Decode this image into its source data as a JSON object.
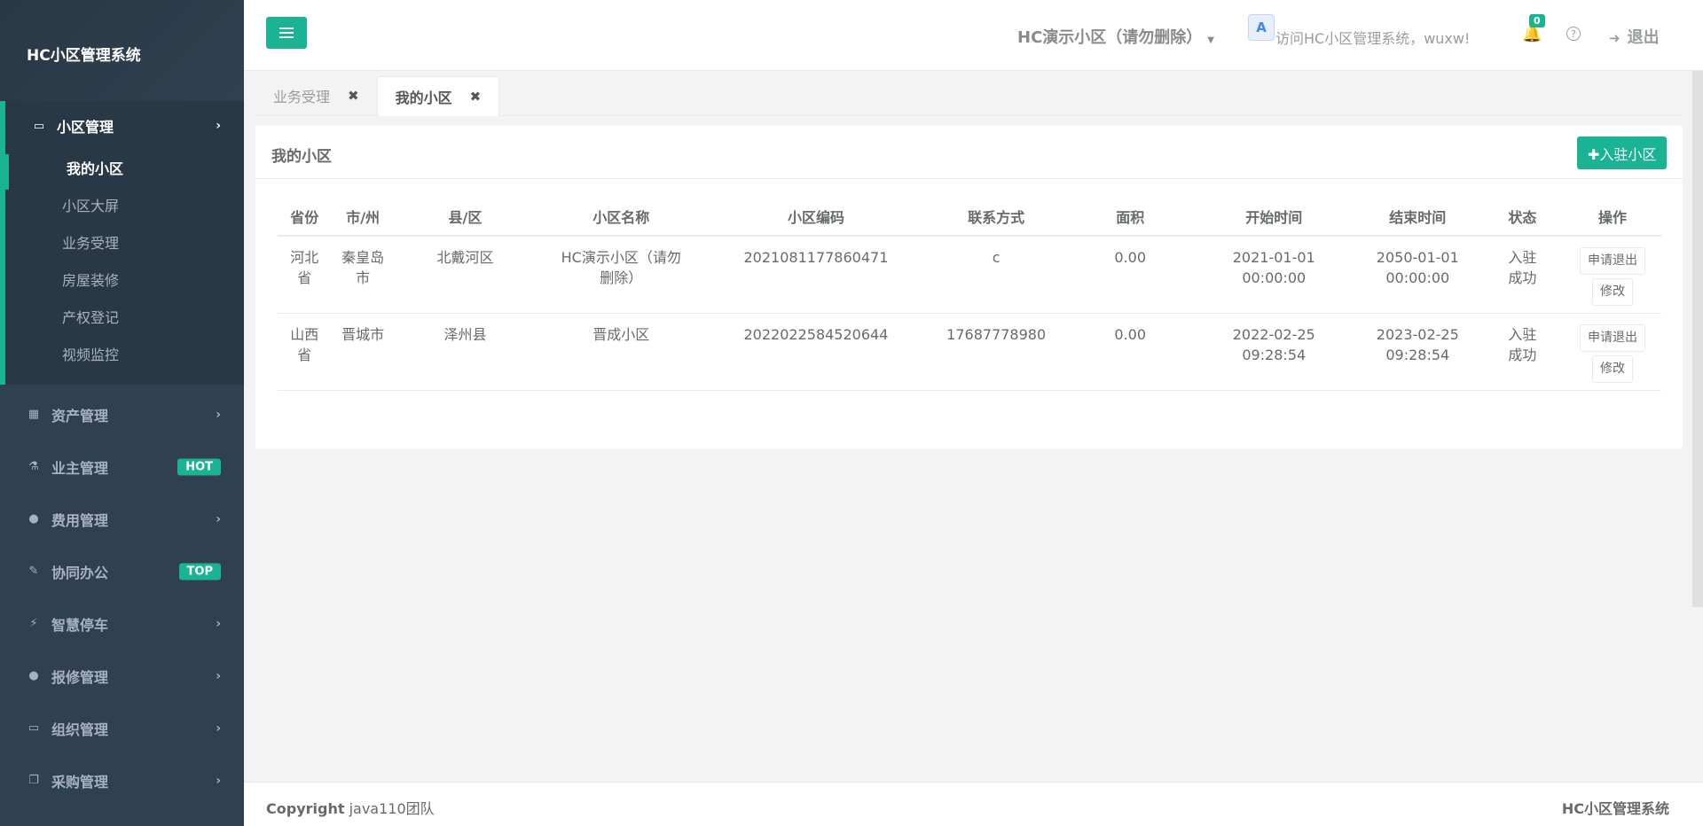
{
  "brand": "HC小区管理系统",
  "sidebar": {
    "active_group": {
      "label": "小区管理",
      "icon": "laptop-icon",
      "arrow": "›"
    },
    "sub_items": [
      {
        "label": "我的小区",
        "active": true
      },
      {
        "label": "小区大屏"
      },
      {
        "label": "业务受理"
      },
      {
        "label": "房屋装修"
      },
      {
        "label": "产权登记"
      },
      {
        "label": "视频监控"
      }
    ],
    "groups": [
      {
        "label": "资产管理",
        "icon": "grid-icon",
        "glyph": "▦",
        "arrow": "›"
      },
      {
        "label": "业主管理",
        "icon": "flask-icon",
        "glyph": "⚗",
        "badge": "HOT"
      },
      {
        "label": "费用管理",
        "icon": "globe-icon",
        "glyph": "●",
        "arrow": "›"
      },
      {
        "label": "协同办公",
        "icon": "edit-icon",
        "glyph": "✎",
        "badge": "TOP"
      },
      {
        "label": "智慧停车",
        "icon": "bolt-icon",
        "glyph": "⚡",
        "arrow": "›"
      },
      {
        "label": "报修管理",
        "icon": "globe-icon",
        "glyph": "●",
        "arrow": "›"
      },
      {
        "label": "组织管理",
        "icon": "desktop-icon",
        "glyph": "▭",
        "arrow": "›"
      },
      {
        "label": "采购管理",
        "icon": "copy-icon",
        "glyph": "❐",
        "arrow": "›"
      }
    ]
  },
  "header": {
    "community": "HC演示小区（请勿删除）",
    "translate_label": "A",
    "welcome": "访问HC小区管理系统，wuxw!",
    "notification_count": "0",
    "help": "?",
    "logout": "退出"
  },
  "tabs": [
    {
      "label": "业务受理",
      "close": "✖"
    },
    {
      "label": "我的小区",
      "close": "✖"
    }
  ],
  "panel": {
    "title": "我的小区",
    "join_button": "✚入驻小区"
  },
  "table": {
    "headers": [
      "省份",
      "市/州",
      "县/区",
      "小区名称",
      "小区编码",
      "联系方式",
      "面积",
      "开始时间",
      "结束时间",
      "状态",
      "操作"
    ],
    "rows": [
      {
        "province": "河北省",
        "city": "秦皇岛市",
        "district": "北戴河区",
        "name": "HC演示小区（请勿删除）",
        "code": "2021081177860471",
        "contact": "c",
        "area": "0.00",
        "start": "2021-01-01 00:00:00",
        "end": "2050-01-01 00:00:00",
        "status": "入驻成功",
        "btn_exit": "申请退出",
        "btn_edit": "修改"
      },
      {
        "province": "山西省",
        "city": "晋城市",
        "district": "泽州县",
        "name": "晋成小区",
        "code": "2022022584520644",
        "contact": "17687778980",
        "area": "0.00",
        "start": "2022-02-25 09:28:54",
        "end": "2023-02-25 09:28:54",
        "status": "入驻成功",
        "btn_exit": "申请退出",
        "btn_edit": "修改"
      }
    ]
  },
  "footer": {
    "copyright_label": "Copyright",
    "copyright_team": "java110团队",
    "system_name": "HC小区管理系统"
  },
  "colors": {
    "accent": "#1ab394",
    "sidebar": "#2f4050",
    "sidebar_dark": "#293846"
  }
}
